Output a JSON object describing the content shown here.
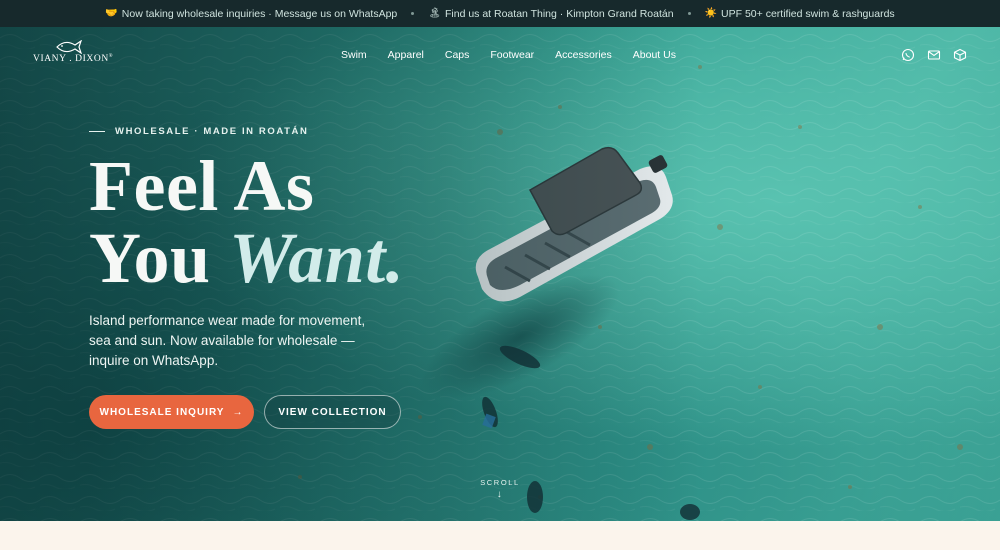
{
  "announcement": {
    "items": [
      {
        "emoji": "🤝",
        "text": "Now taking wholesale inquiries · Message us on WhatsApp"
      },
      {
        "emoji": "🏝",
        "text": "Find us at Roatan Thing · Kimpton Grand Roatán"
      },
      {
        "emoji": "☀️",
        "text": "UPF 50+ certified swim & rashguards"
      }
    ]
  },
  "brand": {
    "name": "VIANY . DIXON",
    "mark": "®"
  },
  "nav": {
    "items": [
      "Swim",
      "Apparel",
      "Caps",
      "Footwear",
      "Accessories",
      "About Us"
    ],
    "icons": [
      "whatsapp-icon",
      "mail-icon",
      "box-icon"
    ]
  },
  "hero": {
    "eyebrow": "WHOLESALE · MADE IN ROATÁN",
    "headline_line1": "Feel As",
    "headline_line2_plain": "You ",
    "headline_line2_italic": "Want.",
    "subtitle": "Island performance wear made for movement, sea and sun. Now available for wholesale — inquire on WhatsApp.",
    "primary_cta": "WHOLESALE INQUIRY",
    "primary_cta_arrow": "→",
    "secondary_cta": "VIEW COLLECTION",
    "scroll_label": "SCROLL",
    "scroll_arrow": "↓"
  },
  "colors": {
    "announce_bg": "#17292c",
    "accent": "#e8663f",
    "water": "#2f9a8d",
    "cream": "#fbf4ec"
  }
}
